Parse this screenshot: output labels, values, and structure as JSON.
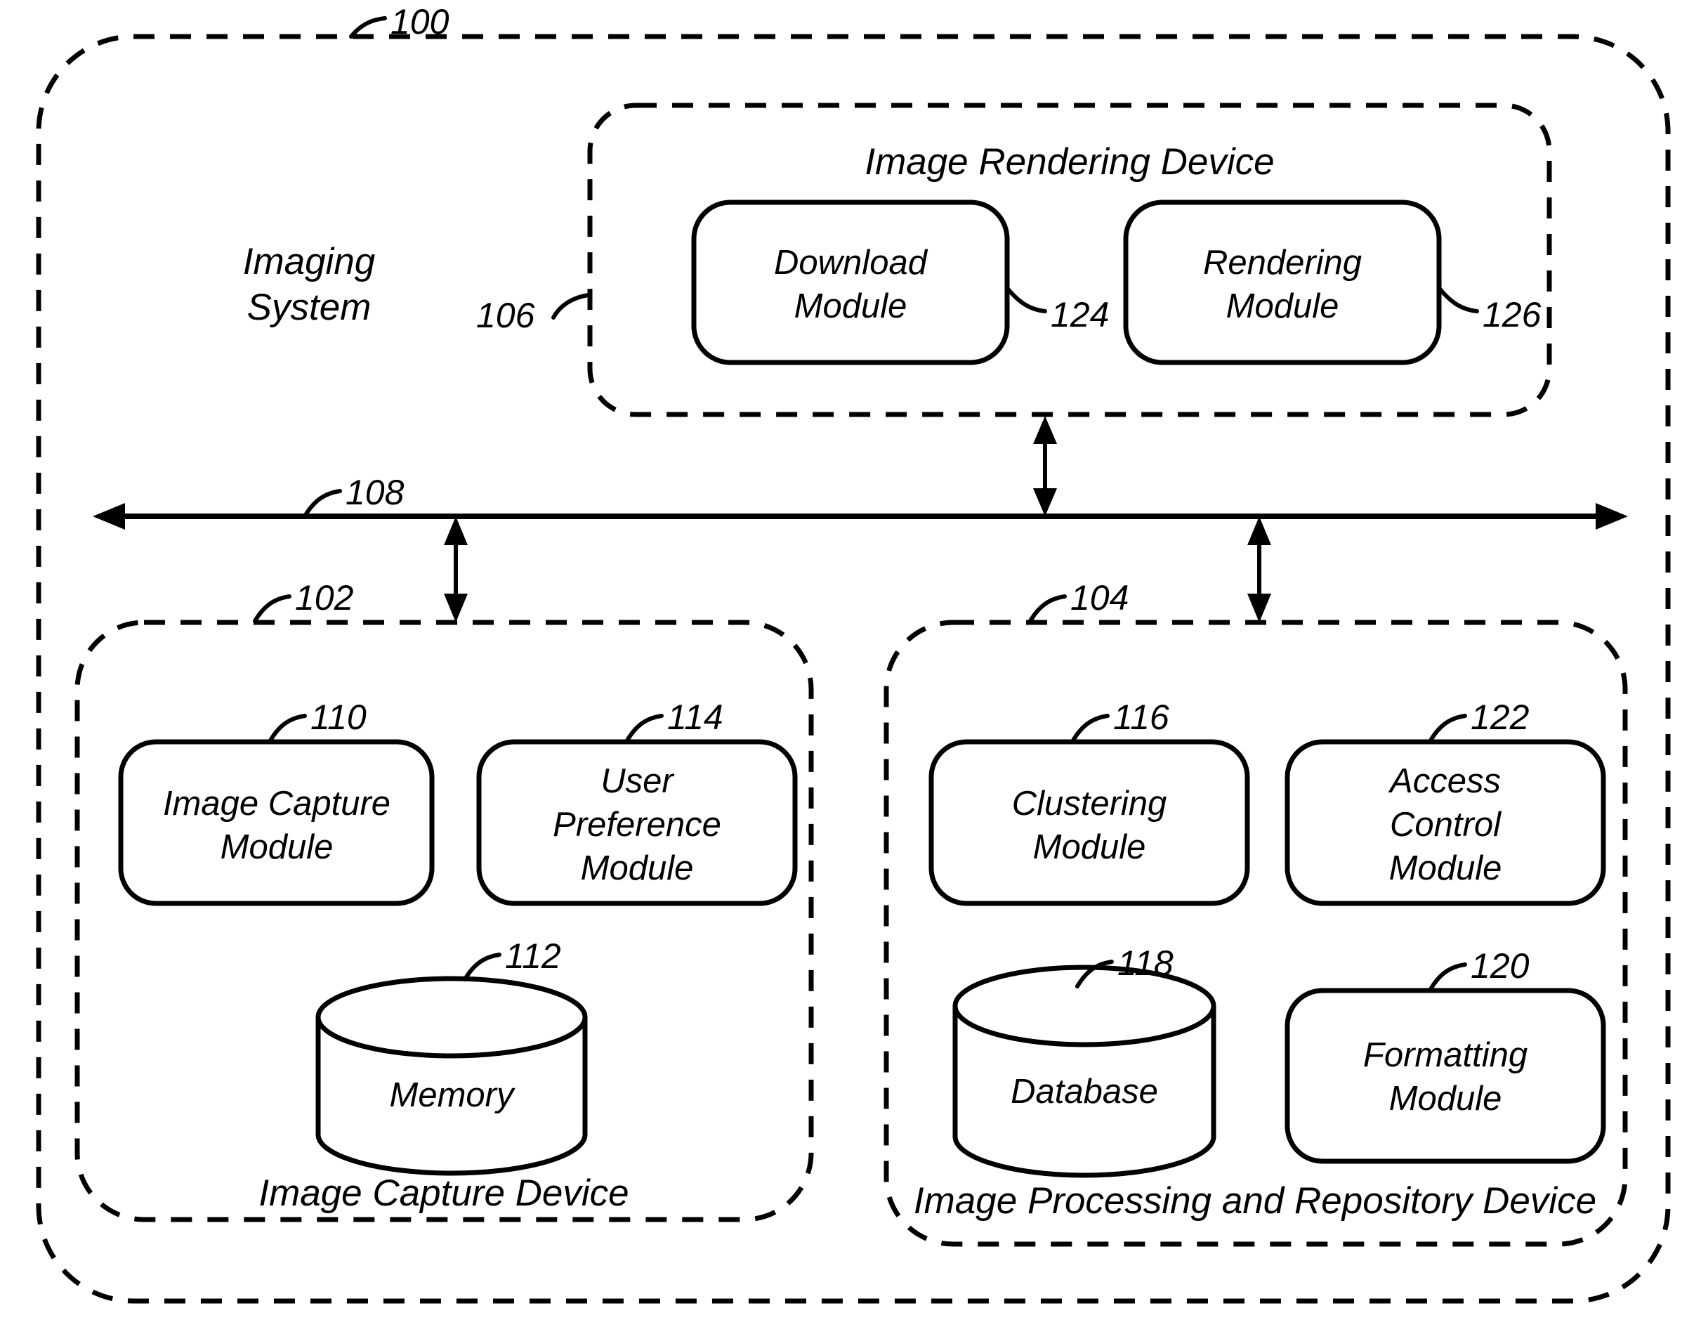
{
  "figure": {
    "system": {
      "ref": "100",
      "label_line1": "Imaging",
      "label_line2": "System"
    },
    "bus": {
      "ref": "108"
    },
    "rendering_device": {
      "ref": "106",
      "title": "Image Rendering Device",
      "modules": [
        {
          "ref": "124",
          "line1": "Download",
          "line2": "Module"
        },
        {
          "ref": "126",
          "line1": "Rendering",
          "line2": "Module"
        }
      ]
    },
    "capture_device": {
      "ref": "102",
      "title": "Image Capture Device",
      "modules": [
        {
          "ref": "110",
          "line1": "Image Capture",
          "line2": "Module"
        },
        {
          "ref": "114",
          "line1": "User",
          "line2": "Preference",
          "line3": "Module"
        }
      ],
      "store": {
        "ref": "112",
        "label": "Memory"
      }
    },
    "processing_device": {
      "ref": "104",
      "title": "Image Processing and Repository Device",
      "modules": [
        {
          "ref": "116",
          "line1": "Clustering",
          "line2": "Module"
        },
        {
          "ref": "122",
          "line1": "Access",
          "line2": "Control",
          "line3": "Module"
        },
        {
          "ref": "120",
          "line1": "Formatting",
          "line2": "Module"
        }
      ],
      "store": {
        "ref": "118",
        "label": "Database"
      }
    },
    "colors": {
      "ink": "#000000",
      "paper": "#ffffff"
    }
  }
}
